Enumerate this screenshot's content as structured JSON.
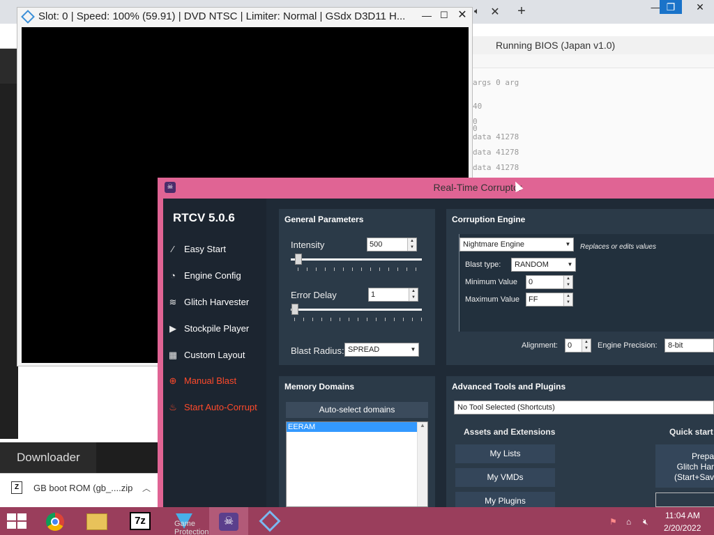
{
  "browser": {
    "page_heading": "Running BIOS (Japan v1.0)",
    "console_lines": [
      "args 0 arg",
      "40",
      "0",
      "0",
      "data 41278",
      "data 41278",
      "data 41278"
    ],
    "downloads_label": "Downloader",
    "download_file": "GB boot ROM (gb_....zip",
    "download_file_icon_text": "Z"
  },
  "pcsx2": {
    "title": "Slot: 0 | Speed: 100% (59.91) | DVD NTSC | Limiter: Normal | GSdx D3D11 H..."
  },
  "rtc": {
    "window_title": "Real-Time Corruptor",
    "version": "RTCV 5.0.6",
    "nav": [
      {
        "label": "Easy Start",
        "icon": "wand-icon"
      },
      {
        "label": "Engine Config",
        "icon": "gauge-icon"
      },
      {
        "label": "Glitch Harvester",
        "icon": "layers-icon"
      },
      {
        "label": "Stockpile Player",
        "icon": "play-icon"
      },
      {
        "label": "Custom Layout",
        "icon": "grid-icon"
      },
      {
        "label": "Manual Blast",
        "icon": "crosshair-icon"
      },
      {
        "label": "Start Auto-Corrupt",
        "icon": "fire-icon"
      }
    ],
    "general": {
      "title": "General Parameters",
      "intensity_label": "Intensity",
      "intensity_value": "500",
      "intensity_slider_fraction": 0.06,
      "error_delay_label": "Error Delay",
      "error_delay_value": "1",
      "error_delay_slider_fraction": 0.0,
      "blast_radius_label": "Blast Radius:",
      "blast_radius_value": "SPREAD"
    },
    "engine": {
      "title": "Corruption Engine",
      "engine_value": "Nightmare Engine",
      "engine_desc": "Replaces or edits values",
      "blast_type_label": "Blast type:",
      "blast_type_value": "RANDOM",
      "min_label": "Minimum Value",
      "min_value": "0",
      "max_label": "Maximum Value",
      "max_value": "FF",
      "alignment_label": "Alignment:",
      "alignment_value": "0",
      "precision_label": "Engine Precision:",
      "precision_value": "8-bit"
    },
    "memory": {
      "title": "Memory Domains",
      "auto_select_label": "Auto-select domains",
      "domains": [
        "EERAM"
      ]
    },
    "tools": {
      "title": "Advanced Tools and Plugins",
      "tool_select_value": "No Tool Selected (Shortcuts)",
      "assets_title": "Assets and Extensions",
      "my_lists": "My Lists",
      "my_vmds": "My VMDs",
      "my_plugins": "My Plugins",
      "quick_start_title": "Quick start s",
      "prepare_line1": "Prepa",
      "prepare_line2": "Glitch Har",
      "prepare_line3": "(Start+Sav"
    }
  },
  "taskbar": {
    "time": "11:04 AM",
    "date": "2/20/2022",
    "ghost_label": "Game Protection",
    "accent": "#9a3e5c"
  }
}
